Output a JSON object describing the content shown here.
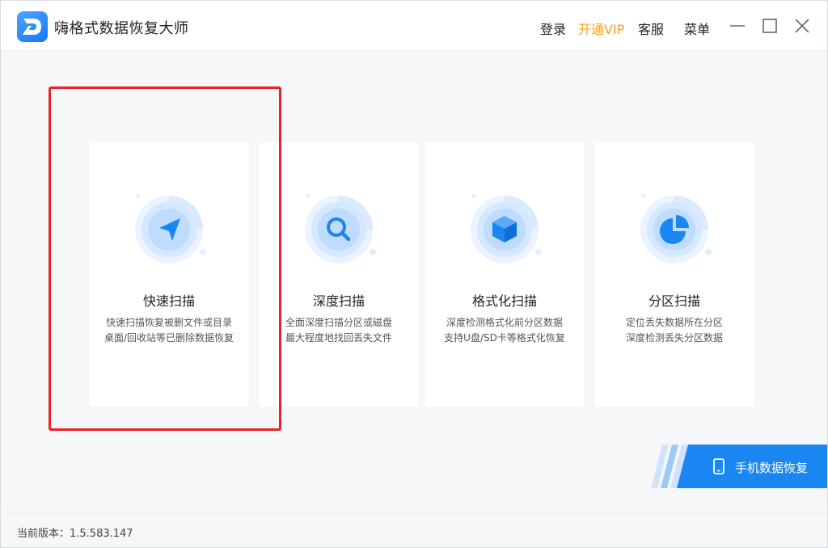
{
  "app": {
    "title": "嗨格式数据恢复大师"
  },
  "header": {
    "login": "登录",
    "vip": "开通VIP",
    "service": "客服",
    "menu": "菜单",
    "icons": [
      "minimize-icon",
      "maximize-icon",
      "close-icon"
    ]
  },
  "colors": {
    "brand": "#1a86f2",
    "vip": "#f6a21a",
    "highlight": "#e8232a"
  },
  "modes": [
    {
      "title": "快速扫描",
      "desc1": "快速扫描恢复被删文件或目录",
      "desc2": "桌面/回收站等已删除数据恢复",
      "icon": "navigation-arrow-icon"
    },
    {
      "title": "深度扫描",
      "desc1": "全面深度扫描分区或磁盘",
      "desc2": "最大程度地找回丢失文件",
      "icon": "magnifier-icon"
    },
    {
      "title": "格式化扫描",
      "desc1": "深度检测格式化前分区数据",
      "desc2": "支持U盘/SD卡等格式化恢复",
      "icon": "cube-icon"
    },
    {
      "title": "分区扫描",
      "desc1": "定位丢失数据所在分区",
      "desc2": "深度检测丢失分区数据",
      "icon": "pie-chart-icon"
    }
  ],
  "phone_recovery": {
    "label": "手机数据恢复",
    "icon": "phone-icon"
  },
  "footer": {
    "version": "当前版本：1.5.583.147"
  }
}
